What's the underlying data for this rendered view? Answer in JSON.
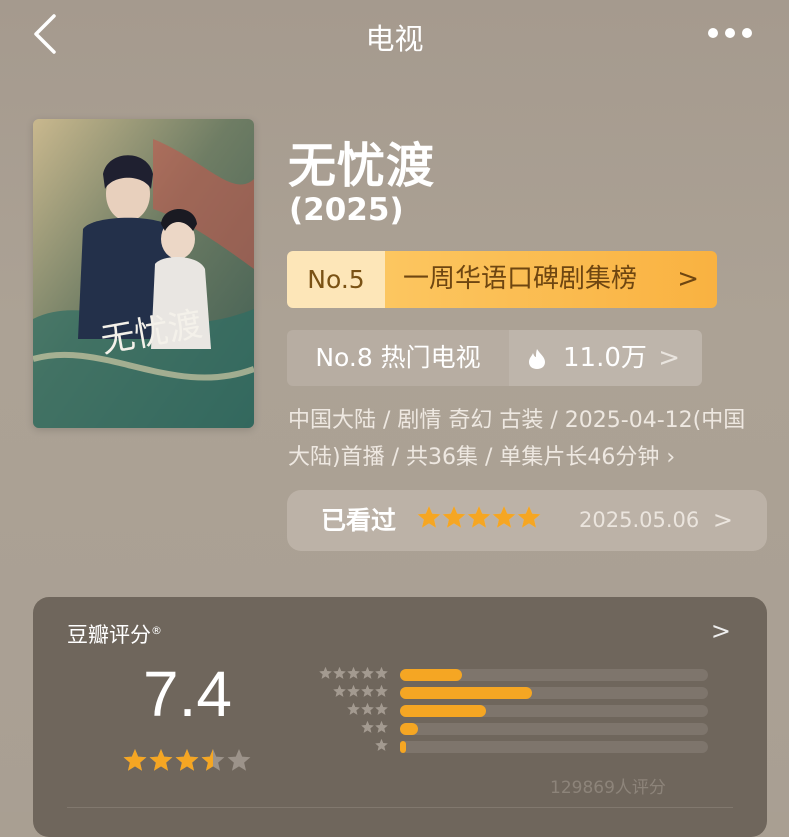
{
  "header": {
    "title": "电视"
  },
  "movie": {
    "title": "无忧渡",
    "year": "(2025)",
    "poster_text": "无忧渡"
  },
  "rankings": {
    "primary": {
      "rank": "No.5",
      "label": "一周华语口碑剧集榜",
      "chevron": ">"
    },
    "secondary": {
      "label": "No.8 热门电视",
      "heat": "11.0万",
      "chevron": ">"
    }
  },
  "meta": {
    "text": "中国大陆 / 剧情 奇幻 古装 / 2025-04-12(中国大陆)首播 / 共36集 / 单集片长46分钟 ›"
  },
  "watched": {
    "label": "已看过",
    "user_stars": 5,
    "date": "2025.05.06",
    "chevron": ">"
  },
  "rating": {
    "label": "豆瓣评分",
    "mark": "®",
    "chevron": ">",
    "score": "7.4",
    "stars": 3.5,
    "distribution": [
      {
        "stars": 5,
        "percent": 20
      },
      {
        "stars": 4,
        "percent": 43
      },
      {
        "stars": 3,
        "percent": 28
      },
      {
        "stars": 2,
        "percent": 6
      },
      {
        "stars": 1,
        "percent": 2
      }
    ],
    "count_text": "129869人评分"
  },
  "colors": {
    "background": "#a99f92",
    "accent_orange": "#f9b241",
    "star": "#f5a623",
    "card": "#6f665c"
  }
}
